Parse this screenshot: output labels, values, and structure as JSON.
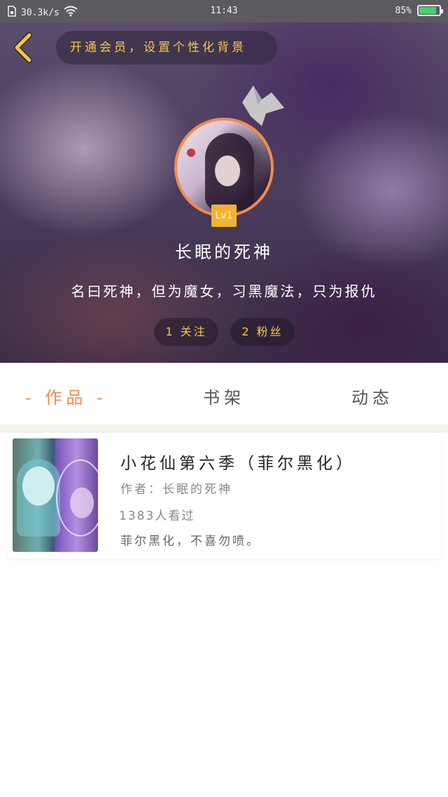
{
  "status_bar": {
    "speed": "30.3k/s",
    "time": "11:43",
    "battery_text": "85%",
    "battery_level": 0.85,
    "battery_color": "#3ed36b"
  },
  "header": {
    "vip_text": "开通会员，设置个性化背景",
    "level": "Lv1",
    "nickname": "长眠的死神",
    "bio": "名曰死神，但为魔女，习黑魔法，只为报仇",
    "follow_label": "1 关注",
    "fans_label": "2 粉丝",
    "accent_color": "#f5c84a"
  },
  "tabs": {
    "works": "- 作品 -",
    "shelf": "书架",
    "feed": "动态",
    "active_color": "#f08c4c"
  },
  "books": [
    {
      "title": "小花仙第六季（菲尔黑化）",
      "author": "作者：长眠的死神",
      "views": "1383人看过",
      "description": "菲尔黑化，不喜勿喷。"
    }
  ]
}
